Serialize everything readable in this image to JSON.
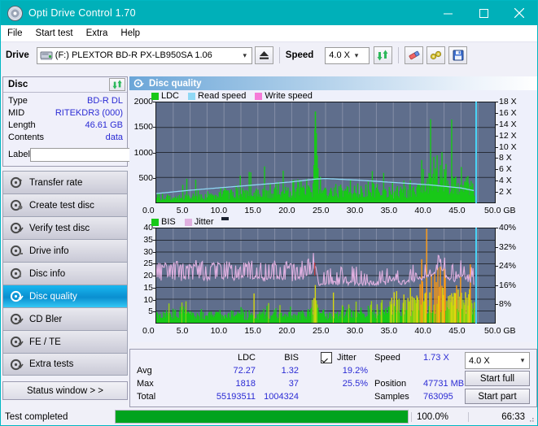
{
  "window": {
    "title": "Opti Drive Control 1.70",
    "icon": "disc-icon",
    "minimize": "minimize-icon",
    "maximize": "maximize-icon",
    "close": "close-icon"
  },
  "menu": {
    "items": [
      "File",
      "Start test",
      "Extra",
      "Help"
    ]
  },
  "toolbar": {
    "drive_label": "Drive",
    "drive_value": "(F:)   PLEXTOR BD-R  PX-LB950SA 1.06",
    "eject_icon": "eject-icon",
    "speed_label": "Speed",
    "speed_value": "4.0 X",
    "refresh_icon": "refresh-icon",
    "erase_icon": "eraser-icon",
    "tools_icon": "tools-icon",
    "save_icon": "save-icon"
  },
  "disc_panel": {
    "title": "Disc",
    "refresh_icon": "refresh-icon",
    "rows": [
      {
        "key": "Type",
        "value": "BD-R DL"
      },
      {
        "key": "MID",
        "value": "RITEKDR3 (000)"
      },
      {
        "key": "Length",
        "value": "46.61 GB"
      },
      {
        "key": "Contents",
        "value": "data"
      }
    ],
    "label_key": "Label",
    "label_value": "",
    "label_placeholder": "",
    "cd_icon": "cd-icon"
  },
  "nav": {
    "items": [
      {
        "label": "Transfer rate",
        "icon": "disc-test-icon",
        "active": false
      },
      {
        "label": "Create test disc",
        "icon": "disc-burn-icon",
        "active": false
      },
      {
        "label": "Verify test disc",
        "icon": "disc-verify-icon",
        "active": false
      },
      {
        "label": "Drive info",
        "icon": "disc-info-icon",
        "active": false
      },
      {
        "label": "Disc info",
        "icon": "disc-info2-icon",
        "active": false
      },
      {
        "label": "Disc quality",
        "icon": "disc-quality-icon",
        "active": true
      },
      {
        "label": "CD Bler",
        "icon": "disc-bler-icon",
        "active": false
      },
      {
        "label": "FE / TE",
        "icon": "disc-fete-icon",
        "active": false
      },
      {
        "label": "Extra tests",
        "icon": "disc-extra-icon",
        "active": false
      }
    ],
    "status_window": "Status window > >"
  },
  "quality": {
    "header": "Disc quality",
    "header_icon": "disc-quality-icon"
  },
  "chart_data": [
    {
      "type": "area",
      "title": "Disc quality - LDC / Read speed",
      "xlabel": "GB",
      "ylabel": "",
      "xlim": [
        0,
        50
      ],
      "ylim": [
        0,
        2000
      ],
      "y2lim": [
        0,
        18
      ],
      "grid": true,
      "legend_position": "top-left",
      "xticks": [
        "0.0",
        "5.0",
        "10.0",
        "15.0",
        "20.0",
        "25.0",
        "30.0",
        "35.0",
        "40.0",
        "45.0",
        "50.0 GB"
      ],
      "yticks": [
        "500",
        "1000",
        "1500",
        "2000"
      ],
      "y2ticks": [
        "2 X",
        "4 X",
        "6 X",
        "8 X",
        "10 X",
        "12 X",
        "14 X",
        "16 X",
        "18 X"
      ],
      "legend": [
        {
          "name": "LDC",
          "color": "#18c818"
        },
        {
          "name": "Read speed",
          "color": "#8fd8f5"
        },
        {
          "name": "Write speed",
          "color": "#f57ad8"
        }
      ],
      "series": [
        {
          "name": "LDC",
          "color": "#18c818",
          "x": [
            0,
            1,
            2,
            3,
            4,
            5,
            6,
            7,
            8,
            9,
            10,
            11,
            12,
            13,
            14,
            15,
            16,
            17,
            18,
            19,
            20,
            21,
            22,
            23,
            23.4,
            24,
            25,
            26,
            27,
            28,
            29,
            30,
            31,
            32,
            33,
            34,
            35,
            36,
            37,
            38,
            39,
            40,
            40.5,
            41,
            41.5,
            42,
            42.5,
            43,
            43.5,
            44,
            44.5,
            45,
            45.5,
            46,
            46.5,
            47
          ],
          "values": [
            120,
            140,
            130,
            150,
            160,
            140,
            170,
            150,
            190,
            210,
            240,
            200,
            230,
            250,
            220,
            260,
            240,
            280,
            260,
            300,
            280,
            320,
            300,
            340,
            1818,
            320,
            330,
            300,
            280,
            300,
            290,
            270,
            300,
            280,
            290,
            300,
            280,
            300,
            320,
            340,
            380,
            620,
            560,
            700,
            780,
            820,
            600,
            560,
            520,
            500,
            480,
            600,
            580,
            520,
            440,
            380
          ]
        },
        {
          "name": "Read speed",
          "color": "#8fd8f5",
          "x": [
            0,
            5,
            10,
            15,
            20,
            23.5,
            25,
            30,
            35,
            40,
            45,
            47
          ],
          "values": [
            1.6,
            2.2,
            2.7,
            3.2,
            3.7,
            4.2,
            4.3,
            4.0,
            3.6,
            3.2,
            2.6,
            2.1
          ]
        },
        {
          "name": "Write speed",
          "color": "#f57ad8",
          "x": [],
          "values": []
        }
      ],
      "cursor_x": 47.0
    },
    {
      "type": "area",
      "title": "Disc quality - BIS / Jitter",
      "xlabel": "GB",
      "ylabel": "",
      "xlim": [
        0,
        50
      ],
      "ylim": [
        0,
        40
      ],
      "y2lim": [
        0,
        40
      ],
      "grid": true,
      "legend_position": "top-left",
      "xticks": [
        "0.0",
        "5.0",
        "10.0",
        "15.0",
        "20.0",
        "25.0",
        "30.0",
        "35.0",
        "40.0",
        "45.0",
        "50.0 GB"
      ],
      "yticks": [
        "5",
        "10",
        "15",
        "20",
        "25",
        "30",
        "35",
        "40"
      ],
      "y2ticks": [
        "8%",
        "16%",
        "24%",
        "32%",
        "40%"
      ],
      "legend": [
        {
          "name": "BIS",
          "color": "#18c818"
        },
        {
          "name": "Jitter",
          "color": "#e0b0e0"
        }
      ],
      "series": [
        {
          "name": "BIS",
          "color": "#18c818",
          "x": [
            0,
            2,
            4,
            6,
            8,
            10,
            12,
            14,
            16,
            18,
            20,
            22,
            23.4,
            24,
            26,
            28,
            30,
            32,
            34,
            35,
            36,
            37,
            38,
            39,
            40,
            41,
            42,
            42.3,
            43,
            44,
            45,
            45.5,
            46,
            46.5,
            47
          ],
          "values": [
            4,
            5,
            6,
            4,
            5,
            4,
            5,
            4,
            5,
            4,
            5,
            4,
            12,
            4,
            4,
            5,
            5,
            6,
            7,
            13,
            9,
            10,
            11,
            12,
            13,
            14,
            16,
            17,
            13,
            12,
            14,
            13,
            12,
            10,
            8
          ]
        },
        {
          "name": "Jitter",
          "color": "#e0b0e0",
          "x": [
            0,
            2,
            4,
            6,
            8,
            10,
            12,
            14,
            16,
            18,
            20,
            22,
            23.4,
            24,
            26,
            28,
            30,
            32,
            34,
            35,
            36,
            38,
            40,
            41,
            42,
            43,
            44,
            45,
            46,
            47
          ],
          "values": [
            21,
            22,
            21,
            22,
            21,
            22,
            21,
            22,
            21,
            22,
            21,
            22,
            25.5,
            17,
            17,
            17,
            17,
            17,
            17,
            19,
            17,
            18,
            20,
            21,
            23,
            19,
            18,
            21,
            18,
            17
          ]
        }
      ],
      "cursor_x": 47.0
    }
  ],
  "stats": {
    "col_ldc": "LDC",
    "col_bis": "BIS",
    "jitter_label": "Jitter",
    "jitter_checked": true,
    "rows": [
      {
        "key": "Avg",
        "ldc": "72.27",
        "bis": "1.32",
        "jitter": "19.2%"
      },
      {
        "key": "Max",
        "ldc": "1818",
        "bis": "37",
        "jitter": "25.5%"
      },
      {
        "key": "Total",
        "ldc": "55193511",
        "bis": "1004324",
        "jitter": ""
      }
    ],
    "speed_key": "Speed",
    "speed_value": "1.73 X",
    "position_key": "Position",
    "position_value": "47731 MB",
    "samples_key": "Samples",
    "samples_value": "763095",
    "speed_select": "4.0 X",
    "start_full": "Start full",
    "start_part": "Start part"
  },
  "statusbar": {
    "text": "Test completed",
    "progress_percent": 100,
    "percent_label": "100.0%",
    "time": "66:33"
  },
  "colors": {
    "accent": "#00b0b9",
    "value_blue": "#2b2bd4",
    "plot_bg": "#5f6e8c",
    "ldc_green": "#18c818",
    "jitter_pink": "#e0b0e0",
    "read_speed": "#8fd8f5",
    "cursor": "#49d3f5",
    "progress_green": "#00a31e"
  }
}
